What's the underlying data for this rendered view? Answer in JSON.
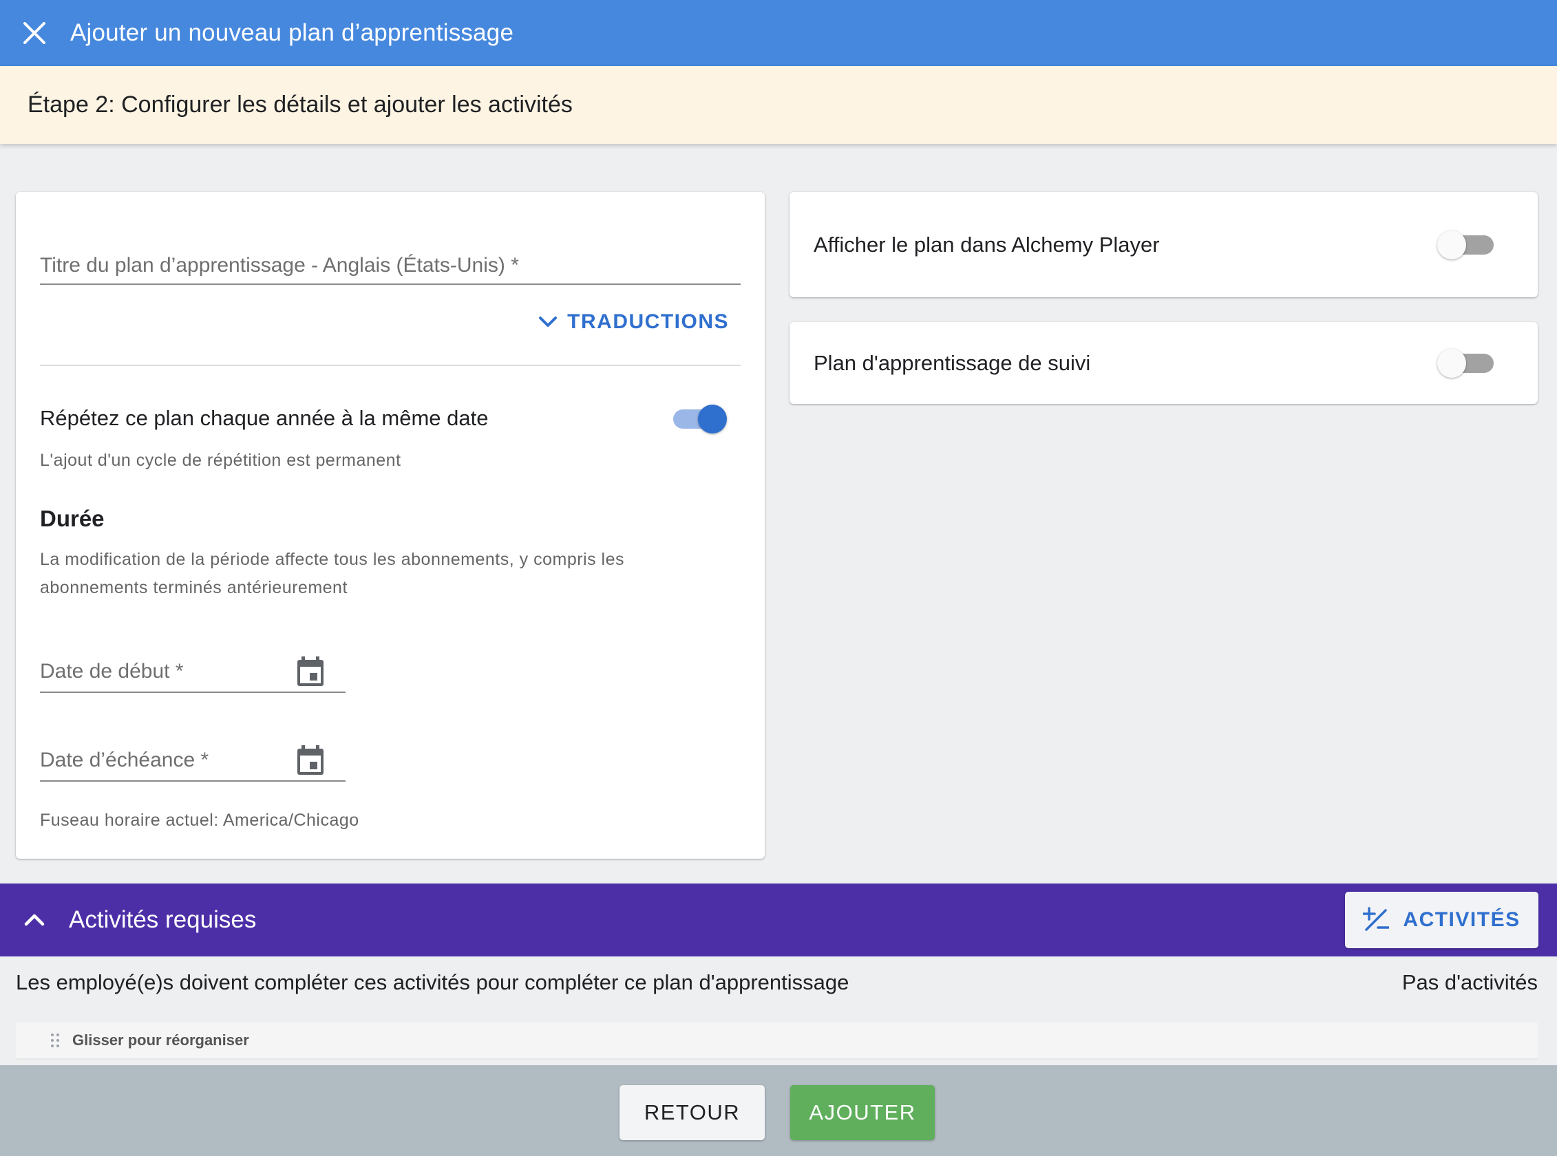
{
  "header": {
    "title": "Ajouter un nouveau plan d’apprentissage",
    "close_icon": "close-icon"
  },
  "step": {
    "title": "Étape 2: Configurer les détails et ajouter les activités"
  },
  "details": {
    "title_field_placeholder": "Titre du plan d’apprentissage - Anglais (États-Unis) *",
    "translations_label": "TRADUCTIONS",
    "repeat_label": "Répétez ce plan chaque année à la même date",
    "repeat_on": true,
    "repeat_hint": "L'ajout d'un cycle de répétition est permanent",
    "duration_title": "Durée",
    "duration_hint": "La modification de la période affecte tous les abonnements, y compris les abonnements terminés antérieurement",
    "start_date_placeholder": "Date de début *",
    "end_date_placeholder": "Date d’échéance *",
    "timezone": "Fuseau horaire actuel: America/Chicago"
  },
  "options": {
    "show_in_player_label": "Afficher le plan dans Alchemy Player",
    "show_in_player_on": false,
    "follow_up_label": "Plan d'apprentissage de suivi",
    "follow_up_on": false
  },
  "activities": {
    "title": "Activités requises",
    "add_button_label": "ACTIVITÉS",
    "description": "Les employé(e)s doivent compléter ces activités pour compléter ce plan d'apprentissage",
    "empty_label": "Pas d'activités",
    "drag_label": "Glisser pour réorganiser"
  },
  "footer": {
    "back_label": "RETOUR",
    "add_label": "AJOUTER"
  },
  "colors": {
    "header": "#4688de",
    "step_bar": "#fdf4e3",
    "activities_bar": "#4c2fa7",
    "accent": "#2f6fce",
    "add_button": "#5faf5c",
    "footer": "#b1bcc2"
  }
}
